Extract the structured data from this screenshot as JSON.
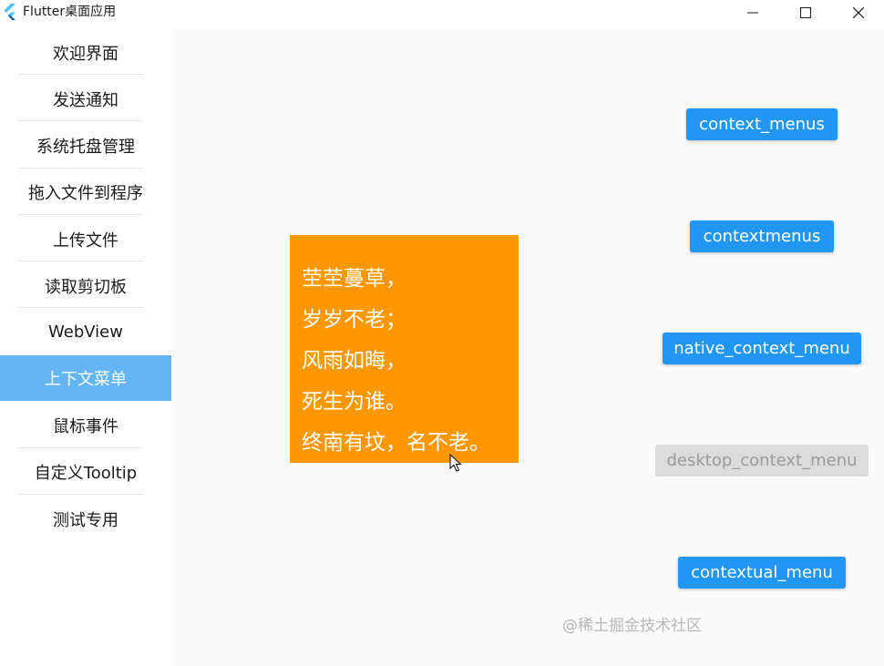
{
  "window": {
    "title": "Flutter桌面应用",
    "logo_icon": "flutter-logo-icon",
    "controls": {
      "minimize_icon": "minimize-icon",
      "maximize_icon": "maximize-icon",
      "close_icon": "close-icon"
    }
  },
  "sidebar": {
    "active_index": 7,
    "active_color": "#64b5f6",
    "items": [
      {
        "label": "欢迎界面"
      },
      {
        "label": "发送通知"
      },
      {
        "label": "系统托盘管理"
      },
      {
        "label": "拖入文件到程序"
      },
      {
        "label": "上传文件"
      },
      {
        "label": "读取剪切板"
      },
      {
        "label": "WebView"
      },
      {
        "label": "上下文菜单"
      },
      {
        "label": "鼠标事件"
      },
      {
        "label": "自定义Tooltip"
      },
      {
        "label": "测试专用"
      }
    ]
  },
  "main": {
    "poem": {
      "background": "#ff9800",
      "lines": [
        "茔茔蔓草，",
        "岁岁不老；",
        "风雨如晦，",
        "死生为谁。",
        "终南有坟，名不老。"
      ]
    },
    "buttons": [
      {
        "label": "context_menus",
        "enabled": true
      },
      {
        "label": "contextmenus",
        "enabled": true
      },
      {
        "label": "native_context_menu",
        "enabled": true
      },
      {
        "label": "desktop_context_menu",
        "enabled": false
      },
      {
        "label": "contextual_menu",
        "enabled": true
      }
    ],
    "button_color": "#2196f3",
    "cursor_icon": "mouse-pointer-icon"
  },
  "watermark": "@稀土掘金技术社区"
}
